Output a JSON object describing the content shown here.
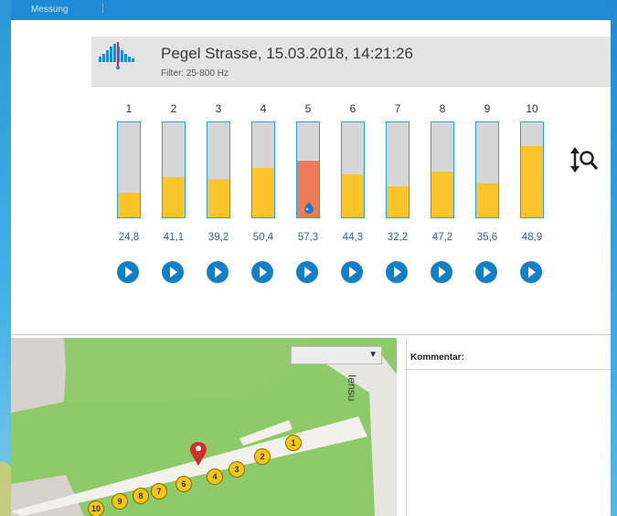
{
  "menu": {
    "item": "Messung"
  },
  "measurement": {
    "title": "Pegel Strasse, 15.03.2018, 14:21:26",
    "filter": "Filter: 25-800 Hz",
    "active_channel": 5,
    "channels": [
      {
        "number": "1",
        "value": "24,8",
        "level": 0.26
      },
      {
        "number": "2",
        "value": "41,1",
        "level": 0.42
      },
      {
        "number": "3",
        "value": "39,2",
        "level": 0.4
      },
      {
        "number": "4",
        "value": "50,4",
        "level": 0.52
      },
      {
        "number": "5",
        "value": "57,3",
        "level": 0.6
      },
      {
        "number": "6",
        "value": "44,3",
        "level": 0.45
      },
      {
        "number": "7",
        "value": "32,2",
        "level": 0.33
      },
      {
        "number": "8",
        "value": "47,2",
        "level": 0.48
      },
      {
        "number": "9",
        "value": "35,6",
        "level": 0.36
      },
      {
        "number": "10",
        "value": "48,9",
        "level": 0.75
      }
    ]
  },
  "map": {
    "street_label": "Iensu",
    "markers": [
      "1",
      "2",
      "3",
      "4",
      "6",
      "7",
      "8",
      "9",
      "10"
    ]
  },
  "comment": {
    "label": "Kommentar:"
  },
  "colors": {
    "menubar": "#1e8bd6",
    "bar_fill": "#fbc52b",
    "bar_fill_active": "#ea7c56",
    "value_text": "#2e5fa7",
    "play_button": "#137fc6"
  }
}
